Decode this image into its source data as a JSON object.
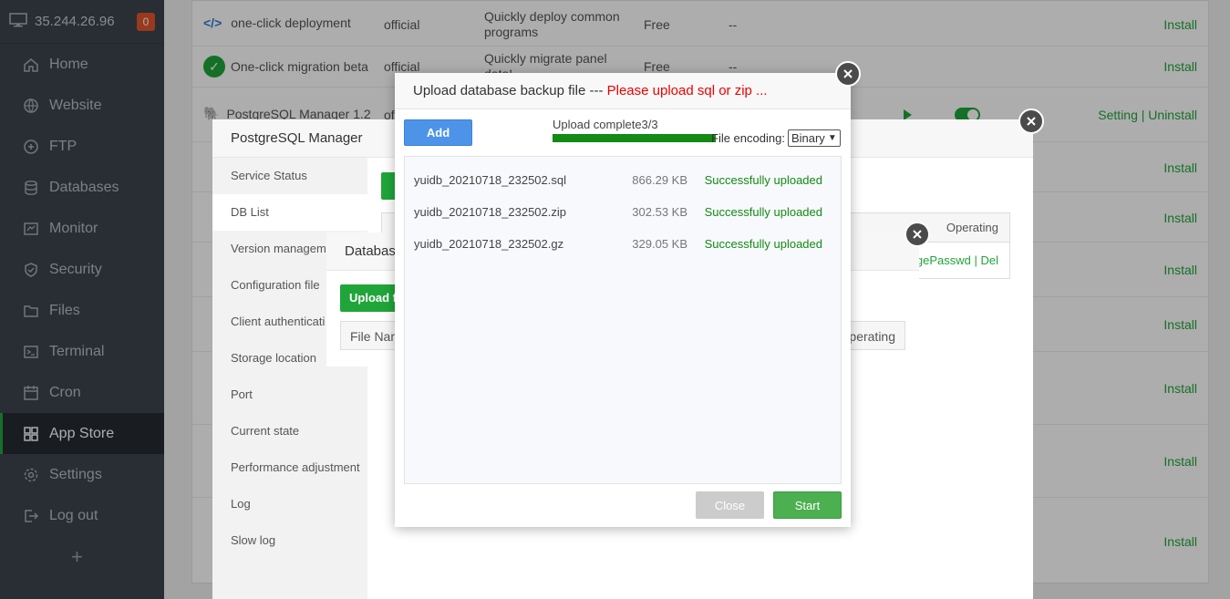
{
  "sidebar": {
    "ip": "35.244.26.96",
    "badge": "0",
    "items": [
      {
        "label": "Home",
        "icon": "home-icon"
      },
      {
        "label": "Website",
        "icon": "globe-icon"
      },
      {
        "label": "FTP",
        "icon": "ftp-icon"
      },
      {
        "label": "Databases",
        "icon": "database-icon"
      },
      {
        "label": "Monitor",
        "icon": "monitor-icon"
      },
      {
        "label": "Security",
        "icon": "shield-icon"
      },
      {
        "label": "Files",
        "icon": "folder-icon"
      },
      {
        "label": "Terminal",
        "icon": "terminal-icon"
      },
      {
        "label": "Cron",
        "icon": "calendar-icon"
      },
      {
        "label": "App Store",
        "icon": "grid-icon"
      },
      {
        "label": "Settings",
        "icon": "gear-icon"
      },
      {
        "label": "Log out",
        "icon": "logout-icon"
      }
    ],
    "plus": "+"
  },
  "apps": {
    "rows": [
      {
        "name": "one-click deployment",
        "dev": "official",
        "desc": "Quickly deploy common programs",
        "price": "Free",
        "expire": "--",
        "action": "Install"
      },
      {
        "name": "One-click migration beta",
        "dev": "official",
        "desc": "Quickly migrate panel data!",
        "price": "Free",
        "expire": "--",
        "action": "Install"
      },
      {
        "name": "PostgreSQL Manager 1.2",
        "dev": "of",
        "action": "Setting | Uninstall"
      }
    ],
    "install": "Install"
  },
  "pg_manager": {
    "title": "PostgreSQL Manager",
    "menu": [
      "Service Status",
      "DB List",
      "Version managem",
      "Configuration file",
      "Client authenticati",
      "Storage location",
      "Port",
      "Current state",
      "Performance adjustment",
      "Log",
      "Slow log"
    ],
    "table_header_op": "Operating",
    "row_ops": "ngePasswd | Del"
  },
  "db_window": {
    "title": "Databas",
    "upload_btn": "Upload f",
    "col_filename": "File Nam",
    "col_operating": "perating"
  },
  "upload_dialog": {
    "title_prefix": "Upload database backup file --- ",
    "title_warn": "Please upload sql or zip ...",
    "add_btn": "Add",
    "progress_text": "Upload complete3/3",
    "progress_fraction": 1.0,
    "encoding_label": "File encoding:",
    "encoding_value": "Binary",
    "files": [
      {
        "name": "yuidb_20210718_232502.sql",
        "size": "866.29 KB",
        "status": "Successfully uploaded"
      },
      {
        "name": "yuidb_20210718_232502.zip",
        "size": "302.53 KB",
        "status": "Successfully uploaded"
      },
      {
        "name": "yuidb_20210718_232502.gz",
        "size": "329.05 KB",
        "status": "Successfully uploaded"
      }
    ],
    "close_btn": "Close",
    "start_btn": "Start"
  }
}
